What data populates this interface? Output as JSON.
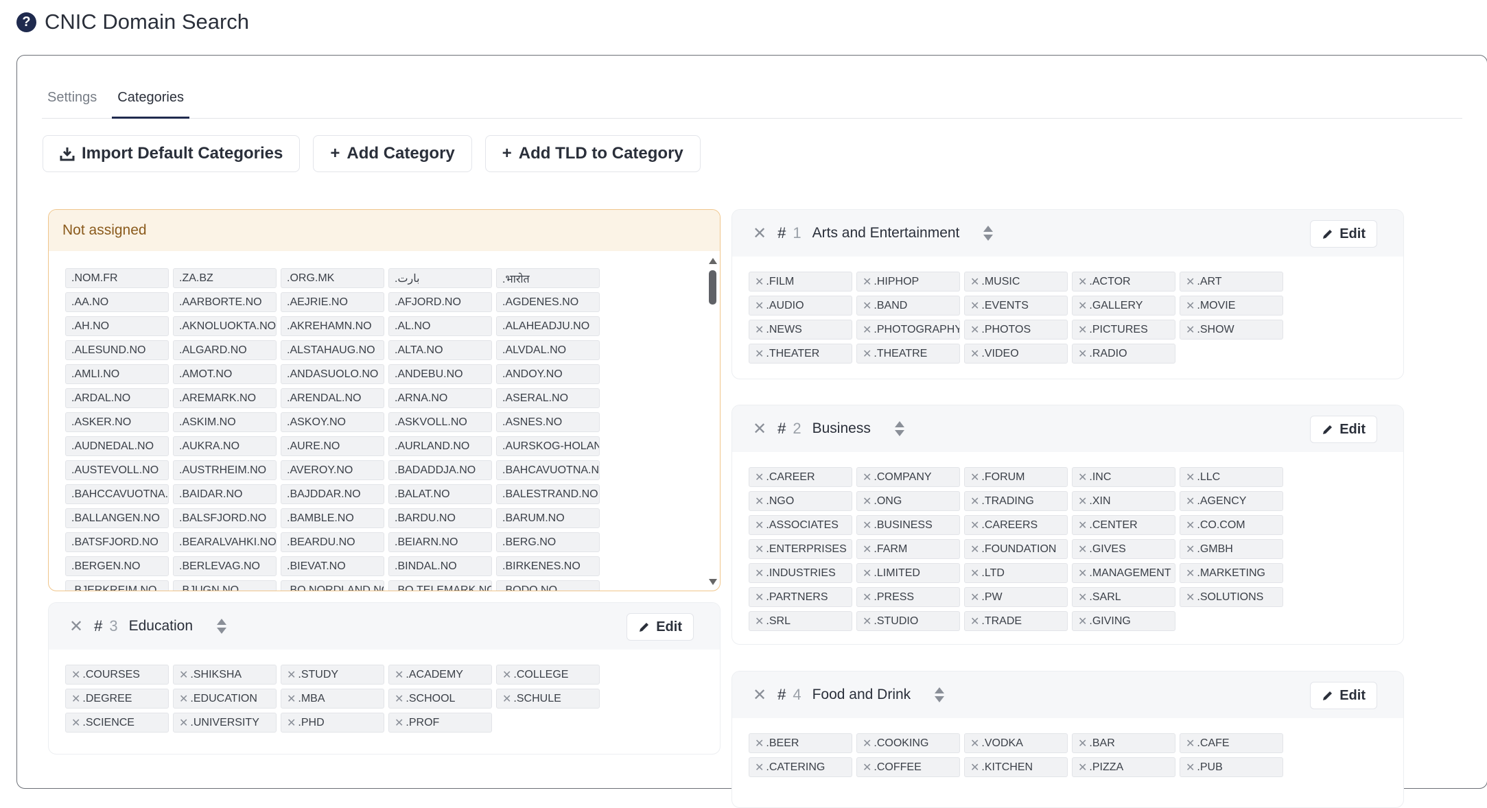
{
  "page": {
    "title": "CNIC Domain Search"
  },
  "tabs": [
    {
      "label": "Settings",
      "active": false
    },
    {
      "label": "Categories",
      "active": true
    }
  ],
  "toolbar": {
    "import_label": "Import Default Categories",
    "add_category_label": "Add Category",
    "add_tld_label": "Add TLD to Category"
  },
  "not_assigned": {
    "title": "Not assigned",
    "tlds": [
      ".NOM.FR",
      ".ZA.BZ",
      ".ORG.MK",
      ".ﺑﺎﺭﺕ",
      ".भारोत",
      ".AA.NO",
      ".AARBORTE.NO",
      ".AEJRIE.NO",
      ".AFJORD.NO",
      ".AGDENES.NO",
      ".AH.NO",
      ".AKNOLUOKTA.NO",
      ".AKREHAMN.NO",
      ".AL.NO",
      ".ALAHEADJU.NO",
      ".ALESUND.NO",
      ".ALGARD.NO",
      ".ALSTAHAUG.NO",
      ".ALTA.NO",
      ".ALVDAL.NO",
      ".AMLI.NO",
      ".AMOT.NO",
      ".ANDASUOLO.NO",
      ".ANDEBU.NO",
      ".ANDOY.NO",
      ".ARDAL.NO",
      ".AREMARK.NO",
      ".ARENDAL.NO",
      ".ARNA.NO",
      ".ASERAL.NO",
      ".ASKER.NO",
      ".ASKIM.NO",
      ".ASKOY.NO",
      ".ASKVOLL.NO",
      ".ASNES.NO",
      ".AUDNEDAL.NO",
      ".AUKRA.NO",
      ".AURE.NO",
      ".AURLAND.NO",
      ".AURSKOG-HOLAND.NO",
      ".AUSTEVOLL.NO",
      ".AUSTRHEIM.NO",
      ".AVEROY.NO",
      ".BADADDJA.NO",
      ".BAHCAVUOTNA.NO",
      ".BAHCCAVUOTNA.NO",
      ".BAIDAR.NO",
      ".BAJDDAR.NO",
      ".BALAT.NO",
      ".BALESTRAND.NO",
      ".BALLANGEN.NO",
      ".BALSFJORD.NO",
      ".BAMBLE.NO",
      ".BARDU.NO",
      ".BARUM.NO",
      ".BATSFJORD.NO",
      ".BEARALVAHKI.NO",
      ".BEARDU.NO",
      ".BEIARN.NO",
      ".BERG.NO",
      ".BERGEN.NO",
      ".BERLEVAG.NO",
      ".BIEVAT.NO",
      ".BINDAL.NO",
      ".BIRKENES.NO",
      ".BJERKREIM.NO",
      ".BJUGN.NO",
      ".BO.NORDLAND.NO",
      ".BO.TELEMARK.NO",
      ".BODO.NO"
    ]
  },
  "categories": [
    {
      "x": "✕",
      "hash": "#",
      "num": "1",
      "name": "Arts and Entertainment",
      "edit_label": "Edit",
      "tlds": [
        ".FILM",
        ".HIPHOP",
        ".MUSIC",
        ".ACTOR",
        ".ART",
        ".AUDIO",
        ".BAND",
        ".EVENTS",
        ".GALLERY",
        ".MOVIE",
        ".NEWS",
        ".PHOTOGRAPHY",
        ".PHOTOS",
        ".PICTURES",
        ".SHOW",
        ".THEATER",
        ".THEATRE",
        ".VIDEO",
        ".RADIO"
      ]
    },
    {
      "x": "✕",
      "hash": "#",
      "num": "2",
      "name": "Business",
      "edit_label": "Edit",
      "tlds": [
        ".CAREER",
        ".COMPANY",
        ".FORUM",
        ".INC",
        ".LLC",
        ".NGO",
        ".ONG",
        ".TRADING",
        ".XIN",
        ".AGENCY",
        ".ASSOCIATES",
        ".BUSINESS",
        ".CAREERS",
        ".CENTER",
        ".CO.COM",
        ".ENTERPRISES",
        ".FARM",
        ".FOUNDATION",
        ".GIVES",
        ".GMBH",
        ".INDUSTRIES",
        ".LIMITED",
        ".LTD",
        ".MANAGEMENT",
        ".MARKETING",
        ".PARTNERS",
        ".PRESS",
        ".PW",
        ".SARL",
        ".SOLUTIONS",
        ".SRL",
        ".STUDIO",
        ".TRADE",
        ".GIVING"
      ]
    },
    {
      "x": "✕",
      "hash": "#",
      "num": "3",
      "name": "Education",
      "edit_label": "Edit",
      "tlds": [
        ".COURSES",
        ".SHIKSHA",
        ".STUDY",
        ".ACADEMY",
        ".COLLEGE",
        ".DEGREE",
        ".EDUCATION",
        ".MBA",
        ".SCHOOL",
        ".SCHULE",
        ".SCIENCE",
        ".UNIVERSITY",
        ".PHD",
        ".PROF"
      ]
    },
    {
      "x": "✕",
      "hash": "#",
      "num": "4",
      "name": "Food and Drink",
      "edit_label": "Edit",
      "tlds": [
        ".BEER",
        ".COOKING",
        ".VODKA",
        ".BAR",
        ".CAFE",
        ".CATERING",
        ".COFFEE",
        ".KITCHEN",
        ".PIZZA",
        ".PUB"
      ]
    }
  ],
  "icons": {
    "help": "question-circle-icon",
    "download": "download-icon",
    "plus": "plus-icon",
    "pencil": "pencil-icon",
    "sort": "sort-icon",
    "remove": "remove-x-icon"
  },
  "colors": {
    "accent": "#1f2a4e",
    "unassigned_border": "#f0c58a",
    "unassigned_header": "#fbf3e6"
  }
}
